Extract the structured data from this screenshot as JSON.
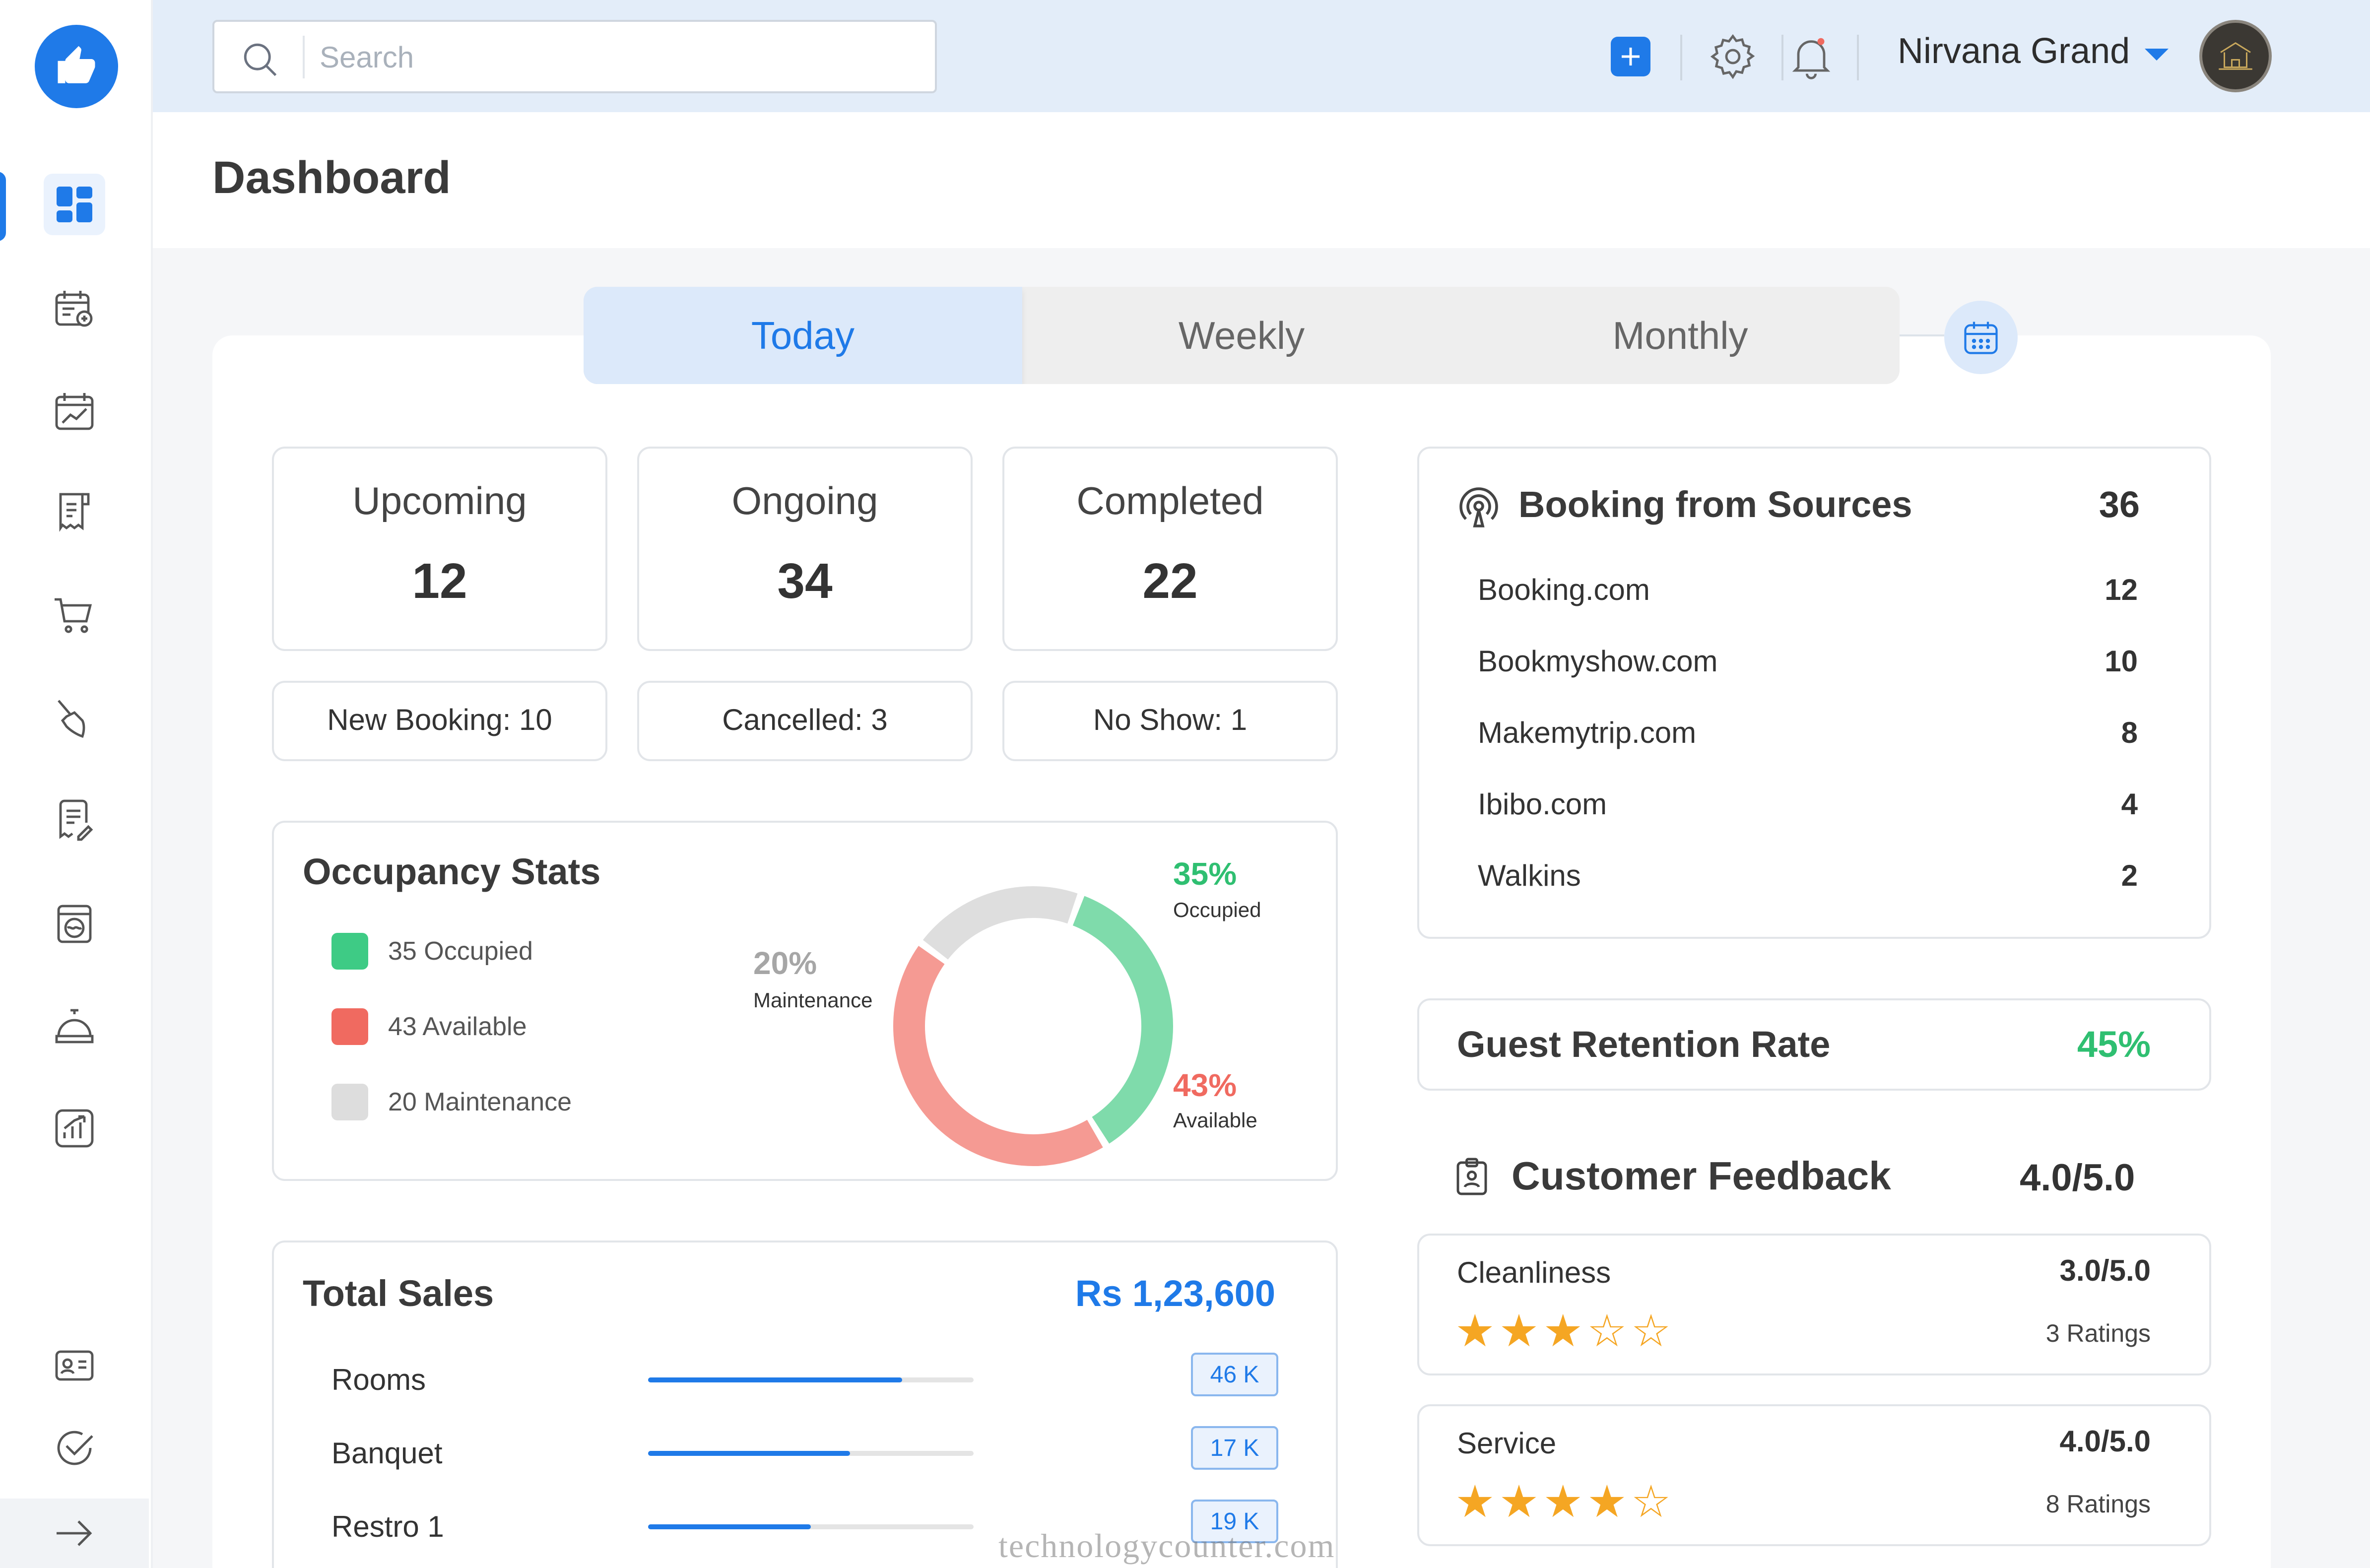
{
  "search": {
    "placeholder": "Search"
  },
  "topbar": {
    "hotel_name": "Nirvana Grand"
  },
  "sidebar": {
    "items": [
      {
        "icon": "dashboard-icon",
        "active": true
      },
      {
        "icon": "calendar-add-icon"
      },
      {
        "icon": "calendar-chart-icon"
      },
      {
        "icon": "receipt-icon"
      },
      {
        "icon": "cart-icon"
      },
      {
        "icon": "broom-icon"
      },
      {
        "icon": "edit-document-icon"
      },
      {
        "icon": "washing-machine-icon"
      },
      {
        "icon": "service-bell-icon"
      },
      {
        "icon": "analytics-icon"
      }
    ],
    "bottom_items": [
      {
        "icon": "id-card-icon"
      },
      {
        "icon": "check-circle-icon"
      },
      {
        "icon": "arrow-right-icon"
      }
    ]
  },
  "page": {
    "title": "Dashboard"
  },
  "tabs": [
    {
      "label": "Today",
      "active": true
    },
    {
      "label": "Weekly"
    },
    {
      "label": "Monthly"
    }
  ],
  "stats": {
    "upcoming": {
      "label": "Upcoming",
      "value": "12"
    },
    "ongoing": {
      "label": "Ongoing",
      "value": "34"
    },
    "completed": {
      "label": "Completed",
      "value": "22"
    },
    "new_booking": "New Booking: 10",
    "cancelled": "Cancelled: 3",
    "no_show": "No Show: 1"
  },
  "occupancy": {
    "title": "Occupancy Stats",
    "legend": [
      {
        "label": "35 Occupied",
        "color": "#3ecb85"
      },
      {
        "label": "43 Available",
        "color": "#f06a60"
      },
      {
        "label": "20 Maintenance",
        "color": "#dddddd"
      }
    ],
    "segments": [
      {
        "pct": "35%",
        "label": "Occupied",
        "color": "#3ecb85",
        "value": 35
      },
      {
        "pct": "43%",
        "label": "Available",
        "color": "#f06a60",
        "value": 43
      },
      {
        "pct": "20%",
        "label": "Maintenance",
        "color": "#a6a6a6",
        "value": 20
      }
    ]
  },
  "sales": {
    "title": "Total Sales",
    "total": "Rs 1,23,600",
    "rows": [
      {
        "label": "Rooms",
        "amount": "46 K",
        "fill": 0.78
      },
      {
        "label": "Banquet",
        "amount": "17 K",
        "fill": 0.62
      },
      {
        "label": "Restro 1",
        "amount": "19 K",
        "fill": 0.5
      }
    ]
  },
  "sources": {
    "title": "Booking from Sources",
    "total": "36",
    "rows": [
      {
        "name": "Booking.com",
        "count": "12"
      },
      {
        "name": "Bookmyshow.com",
        "count": "10"
      },
      {
        "name": "Makemytrip.com",
        "count": "8"
      },
      {
        "name": "Ibibo.com",
        "count": "4"
      },
      {
        "name": "Walkins",
        "count": "2"
      }
    ]
  },
  "retention": {
    "label": "Guest Retention Rate",
    "value": "45%"
  },
  "feedback": {
    "title": "Customer Feedback",
    "score": "4.0/5.0",
    "items": [
      {
        "label": "Cleanliness",
        "score": "3.0/5.0",
        "stars": "★★★☆☆",
        "rating": 3,
        "count": "3 Ratings"
      },
      {
        "label": "Service",
        "score": "4.0/5.0",
        "stars": "★★★★☆",
        "rating": 4,
        "count": "8 Ratings"
      }
    ]
  },
  "watermark": "technologycounter.com",
  "colors": {
    "accent": "#1f7ae8",
    "success": "#2fbf71",
    "danger": "#f06a60",
    "star": "#f5a623"
  }
}
